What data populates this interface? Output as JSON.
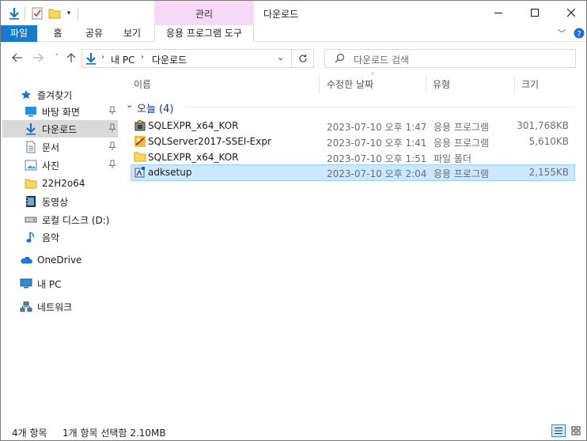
{
  "titlebar": {
    "title": "다운로드",
    "context_group": "관리"
  },
  "ribbon": {
    "tabs": [
      "파일",
      "홈",
      "공유",
      "보기"
    ],
    "context_tab": "응용 프로그램 도구"
  },
  "address": {
    "breadcrumb": [
      "내 PC",
      "다운로드"
    ],
    "search_placeholder": "다운로드 검색"
  },
  "sidebar": {
    "quick_access": "즐겨찾기",
    "items": [
      {
        "label": "바탕 화면",
        "icon": "desktop-icon",
        "pinned": true
      },
      {
        "label": "다운로드",
        "icon": "download-icon",
        "pinned": true
      },
      {
        "label": "문서",
        "icon": "document-icon",
        "pinned": true
      },
      {
        "label": "사진",
        "icon": "picture-icon",
        "pinned": true
      },
      {
        "label": "22H2o64",
        "icon": "folder-icon",
        "pinned": false
      },
      {
        "label": "동영상",
        "icon": "video-icon",
        "pinned": false
      },
      {
        "label": "로컬 디스크 (D:)",
        "icon": "drive-icon",
        "pinned": false
      },
      {
        "label": "음악",
        "icon": "music-icon",
        "pinned": false
      }
    ],
    "onedrive": "OneDrive",
    "thispc": "내 PC",
    "network": "네트워크"
  },
  "columns": {
    "name": "이름",
    "modified": "수정한 날짜",
    "type": "유형",
    "size": "크기"
  },
  "group": {
    "label": "오늘 (4)"
  },
  "files": [
    {
      "name": "SQLEXPR_x64_KOR",
      "modified": "2023-07-10 오후 1:47",
      "type": "응용 프로그램",
      "size": "301,768KB",
      "icon": "installer-icon"
    },
    {
      "name": "SQLServer2017-SSEI-Expr",
      "modified": "2023-07-10 오후 1:41",
      "type": "응용 프로그램",
      "size": "5,610KB",
      "icon": "sql-setup-icon"
    },
    {
      "name": "SQLEXPR_x64_KOR",
      "modified": "2023-07-10 오후 1:51",
      "type": "파일 폴더",
      "size": "",
      "icon": "folder-icon"
    },
    {
      "name": "adksetup",
      "modified": "2023-07-10 오후 2:04",
      "type": "응용 프로그램",
      "size": "2,155KB",
      "icon": "setup-icon"
    }
  ],
  "status": {
    "count": "4개 항목",
    "selection": "1개 항목 선택함 2.10MB"
  },
  "colors": {
    "file_tab": "#1979ca",
    "context_tab": "#f7d8f7",
    "selected_row": "#cce8ff",
    "group_header": "#1e3287"
  }
}
